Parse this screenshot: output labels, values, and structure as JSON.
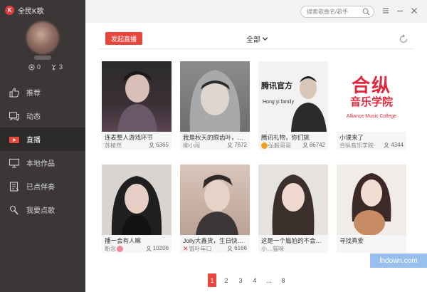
{
  "app": {
    "title": "全民K歌"
  },
  "profile": {
    "stat1": "0",
    "stat2": "3"
  },
  "nav": [
    {
      "label": "推荐",
      "icon": "thumbs-up-icon"
    },
    {
      "label": "动态",
      "icon": "chat-icon"
    },
    {
      "label": "直播",
      "icon": "live-video-icon",
      "active": true
    },
    {
      "label": "本地作品",
      "icon": "monitor-icon"
    },
    {
      "label": "已点伴奏",
      "icon": "list-icon"
    },
    {
      "label": "我要点歌",
      "icon": "microphone-icon"
    }
  ],
  "search": {
    "placeholder": "搜索歌曲名/歌手"
  },
  "toolbar": {
    "live_label": "发起直播",
    "filter_label": "全部"
  },
  "cards": [
    {
      "title": "连麦整人游戏环节",
      "user": "苏棱然",
      "count": "6365",
      "tone": [
        "#2a2a2a",
        "#5a4550",
        "#d8c0b8"
      ]
    },
    {
      "title": "我是秋天的眼齿叶，…",
      "user": "柳小闯",
      "count": "7672",
      "tone": [
        "#6c6e70",
        "#a7a9ab",
        "#e0d6d0"
      ]
    },
    {
      "title": "腾讯礼物，你们挑",
      "user": "弘毅哥哥",
      "count": "86742",
      "tone": [
        "#f2f2f2",
        "#2b2b2b",
        "#d9c7b8"
      ]
    },
    {
      "title": "小课来了",
      "user": "合纵音乐学院",
      "count": "4344",
      "tone": [
        "#ffffff",
        "#e0283c",
        "#e0283c"
      ]
    },
    {
      "title": "播一会有人嘛",
      "user": "断念",
      "count": "10206",
      "tone": [
        "#d8d4d2",
        "#1f1f1f",
        "#e7cfc5"
      ]
    },
    {
      "title": "Jolly大鑫货，生日快…",
      "user": "饿叶年口",
      "count": "6166",
      "tone": [
        "#d9c5ba",
        "#2f2a2a",
        "#bca195"
      ]
    },
    {
      "title": "这是一个尴尬的不会…",
      "user": "小…猫咪",
      "count": "",
      "tone": [
        "#e6e2e0",
        "#3a2f2b",
        "#efd8cf"
      ]
    },
    {
      "title": "寻找真爱",
      "user": "",
      "count": "",
      "tone": [
        "#f1ece8",
        "#3b2a26",
        "#c88c64"
      ]
    }
  ],
  "cardExtra": {
    "alliance_cn": "合纵",
    "alliance_cn2": "音乐学院",
    "alliance_en": "Alliance Music College",
    "hong_title": "腾讯官方",
    "hong_sub": "Hong yi family"
  },
  "pager": {
    "pages": [
      "1",
      "2",
      "3",
      "4",
      "...",
      "8"
    ],
    "current": "1"
  },
  "watermark": "lhdown.com",
  "colors": {
    "sidebar": "#3b3737",
    "accent": "#e8473e"
  }
}
